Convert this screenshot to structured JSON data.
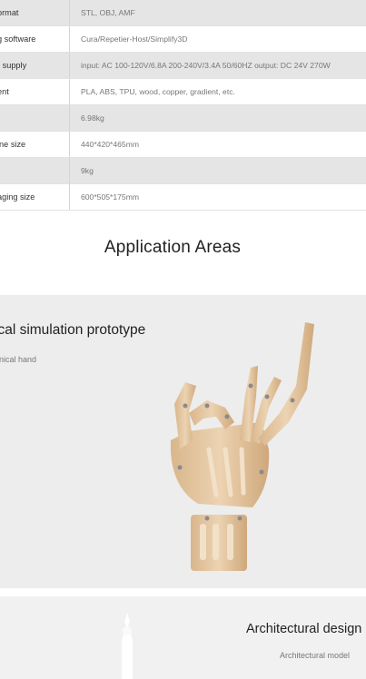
{
  "specs": [
    {
      "key": "ormat",
      "value": "STL, OBJ, AMF"
    },
    {
      "key": "g software",
      "value": "Cura/Repetier-Host/Simplify3D"
    },
    {
      "key": "r supply",
      "value": "input: AC 100-120V/6.8A 200-240V/3.4A 50/60HZ output: DC 24V 270W"
    },
    {
      "key": "ent",
      "value": "PLA, ABS, TPU, wood, copper, gradient, etc."
    },
    {
      "key": "",
      "value": "6.98kg"
    },
    {
      "key": "ine size",
      "value": "440*420*465mm"
    },
    {
      "key": "",
      "value": "9kg"
    },
    {
      "key": "aging size",
      "value": "600*505*175mm"
    }
  ],
  "section": {
    "title": "Application Areas"
  },
  "cards": [
    {
      "title": "ical simulation prototype",
      "subtitle": "anical hand",
      "image_icon": "printed-mechanical-hand-image"
    },
    {
      "title": "Architectural design",
      "subtitle": "Architectural model",
      "image_icon": "printed-architectural-model-image"
    }
  ],
  "colors": {
    "row_alt": "#e5e5e5",
    "card_bg": "#ededed",
    "hand": "#e2c19a"
  }
}
